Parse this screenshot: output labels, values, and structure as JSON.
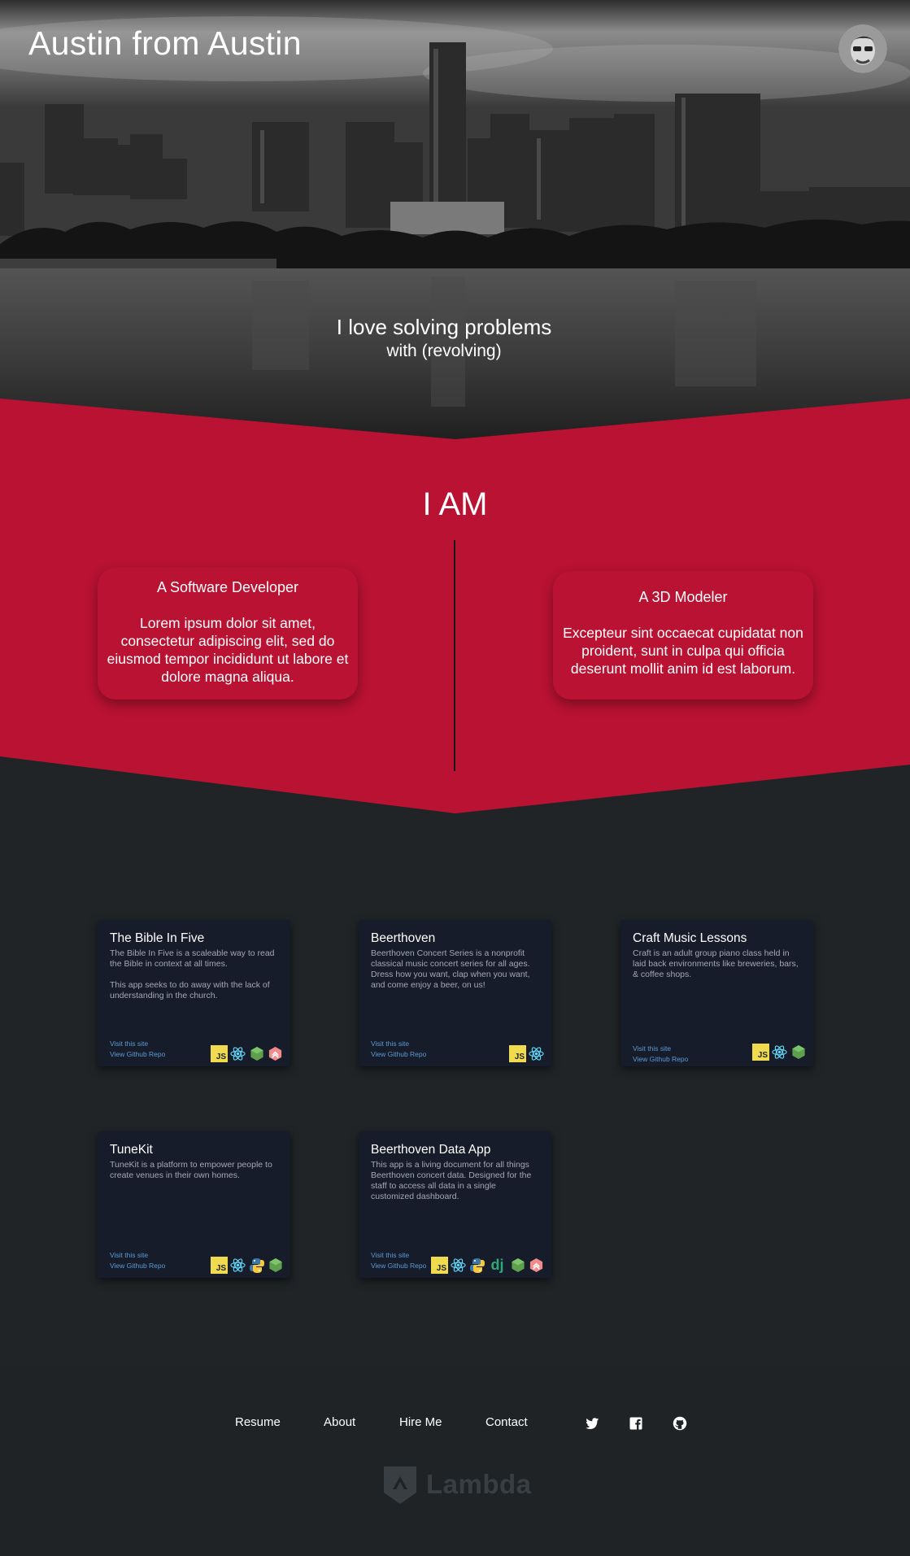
{
  "header": {
    "site_title": "Austin from Austin"
  },
  "hero": {
    "line1": "I love solving problems",
    "line2": "with (revolving)"
  },
  "about": {
    "heading": "I AM",
    "roles": [
      {
        "title": "A Software Developer",
        "text": "Lorem ipsum dolor sit amet, consectetur adipiscing elit, sed do eiusmod tempor incididunt ut labore et dolore magna aliqua."
      },
      {
        "title": "A 3D Modeler",
        "text": "Excepteur sint occaecat cupidatat non proident, sunt in culpa qui officia deserunt mollit anim id est laborum."
      }
    ]
  },
  "projects": [
    {
      "title": "The Bible In Five",
      "description": "The Bible In Five is a scaleable way to read the Bible in context at all times.\n\nThis app seeks to do away with the lack of understanding in the church.",
      "visit_label": "Visit this site",
      "repo_label": "View Github Repo",
      "tech": [
        "js-icon",
        "react-icon",
        "node-icon",
        "redux-saga-icon"
      ]
    },
    {
      "title": "Beerthoven",
      "description": "Beerthoven Concert Series is a nonprofit classical music concert series for all ages. Dress how you want, clap when you want, and come enjoy a beer, on us!",
      "visit_label": "Visit this site",
      "repo_label": "View Github Repo",
      "tech": [
        "js-icon",
        "react-icon"
      ]
    },
    {
      "title": "Craft Music Lessons",
      "description": "Craft is an adult group piano class held in laid back environments like breweries, bars, & coffee shops.",
      "visit_label": "Visit this site",
      "repo_label": "View Github Repo",
      "tech": [
        "js-icon",
        "react-icon",
        "node-icon"
      ]
    },
    {
      "title": "TuneKit",
      "description": "TuneKit is a platform to empower people to create venues in their own homes.",
      "visit_label": "Visit this site",
      "repo_label": "View Github Repo",
      "tech": [
        "js-icon",
        "react-icon",
        "python-icon",
        "node-icon"
      ]
    },
    {
      "title": "Beerthoven Data App",
      "description": "This app is a living document for all things Beerthoven concert data. Designed for the staff to access all data in a single customized dashboard.",
      "visit_label": "Visit this site",
      "repo_label": "View Github Repo",
      "tech": [
        "js-icon",
        "react-icon",
        "python-icon",
        "django-icon",
        "node-icon",
        "redux-saga-icon"
      ]
    }
  ],
  "tech_labels": {
    "js": "JS",
    "django": "dj"
  },
  "footer": {
    "nav": [
      "Resume",
      "About",
      "Hire Me",
      "Contact"
    ],
    "social": [
      "twitter-icon",
      "facebook-icon",
      "github-icon"
    ],
    "brand": "Lambda"
  },
  "colors": {
    "accent_red": "#b91232",
    "page_bg": "#202427",
    "card_bg": "#171c2a",
    "link_blue": "#5b9bd5"
  }
}
